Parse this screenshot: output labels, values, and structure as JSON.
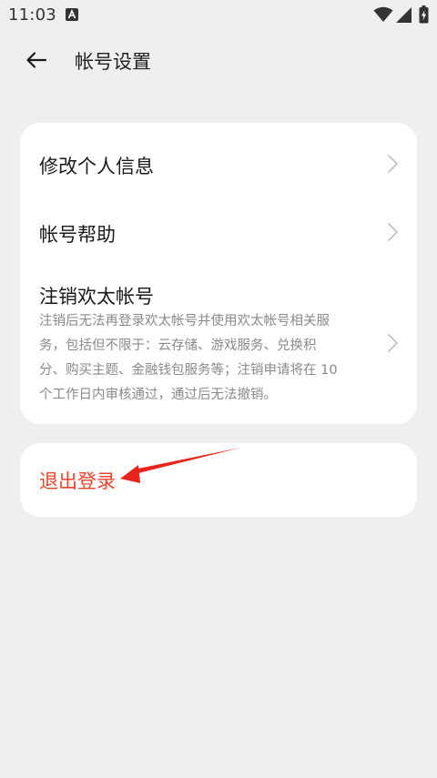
{
  "status_bar": {
    "time": "11:03",
    "notification_icon": "a-icon",
    "wifi_icon": "wifi-icon",
    "signal_icon": "cell-signal-icon",
    "battery_icon": "battery-charging-icon"
  },
  "header": {
    "back_icon": "arrow-left-icon",
    "title": "帐号设置"
  },
  "menu": {
    "items": [
      {
        "label": "修改个人信息",
        "icon": "chevron-right-icon"
      },
      {
        "label": "帐号帮助",
        "icon": "chevron-right-icon"
      },
      {
        "label": "注销欢太帐号",
        "description_lines": [
          "注销后无法再登录欢太帐号并使用欢太帐号相关服",
          "务，包括但不限于：云存储、游戏服务、兑换积",
          "分、购买主题、金融钱包服务等；注销申请将在 10",
          "个工作日内审核通过，通过后无法撤销。"
        ],
        "icon": "chevron-right-icon"
      }
    ]
  },
  "logout": {
    "label": "退出登录"
  },
  "colors": {
    "background": "#efefef",
    "card": "#ffffff",
    "logout_text": "#e8452c",
    "annotation_arrow": "#e8241c",
    "secondary_text": "#8a8a8a",
    "chevron": "#c2c2c2"
  }
}
